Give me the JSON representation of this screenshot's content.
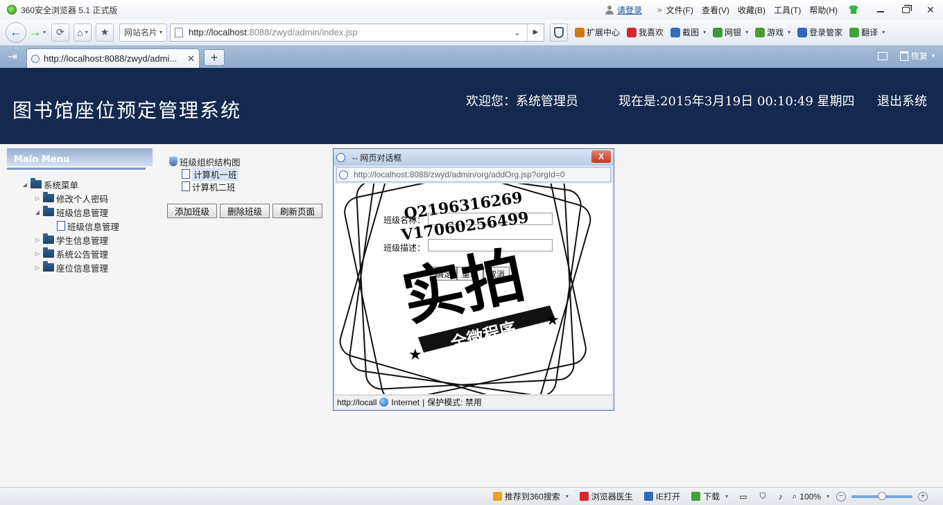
{
  "browser": {
    "app_title": "360安全浏览器 5.1 正式版",
    "login_link": "请登录",
    "menu": [
      "文件(F)",
      "查看(V)",
      "收藏(B)",
      "工具(T)",
      "帮助(H)"
    ],
    "site_card": "网站名片",
    "url_host": "http://localhost",
    "url_rest": ":8088/zwyd/admin/index.jsp",
    "toolbar_items": [
      {
        "icon": "extension-icon",
        "label": "扩展中心",
        "color": "#d27a16"
      },
      {
        "icon": "heart-icon",
        "label": "我喜欢",
        "color": "#d9262e"
      },
      {
        "icon": "screenshot-icon",
        "label": "截图",
        "color": "#2f6fb7"
      },
      {
        "icon": "bank-icon",
        "label": "网银",
        "color": "#3b9a33"
      },
      {
        "icon": "game-icon",
        "label": "游戏",
        "color": "#4d9b2f"
      },
      {
        "icon": "key-icon",
        "label": "登录管家",
        "color": "#2d68b5"
      },
      {
        "icon": "translate-icon",
        "label": "翻译",
        "color": "#3fa23a"
      }
    ],
    "tab_label": "http://localhost:8088/zwyd/admi...",
    "restore_label": "恢复"
  },
  "header": {
    "system_title": "图书馆座位预定管理系统",
    "welcome": "欢迎您：系统管理员",
    "now": "现在是:2015年3月19日  00:10:49 星期四",
    "logout": "退出系统"
  },
  "menu_panel": {
    "heading": "Main Menu",
    "items": [
      {
        "label": "系统菜单",
        "level": 0,
        "expanded": true,
        "type": "folder"
      },
      {
        "label": "修改个人密码",
        "level": 1,
        "expanded": false,
        "type": "folder"
      },
      {
        "label": "班级信息管理",
        "level": 1,
        "expanded": true,
        "type": "folder"
      },
      {
        "label": "班级信息管理",
        "level": 2,
        "expanded": false,
        "type": "doc"
      },
      {
        "label": "学生信息管理",
        "level": 1,
        "expanded": false,
        "type": "folder"
      },
      {
        "label": "系统公告管理",
        "level": 1,
        "expanded": false,
        "type": "folder"
      },
      {
        "label": "座位信息管理",
        "level": 1,
        "expanded": false,
        "type": "folder"
      }
    ]
  },
  "org_tree": {
    "root": "班级组织结构图",
    "children": [
      "计算机一班",
      "计算机二班"
    ],
    "selected": "计算机一班"
  },
  "org_buttons": {
    "add": "添加班级",
    "delete": "删除班级",
    "refresh": "刷新页面"
  },
  "dialog": {
    "title": "-- 网页对话框",
    "url": "http://localhost:8088/zwyd/admin/org/addOrg.jsp?orgId=0",
    "close_label": "X",
    "fields": [
      {
        "label": "班级名称：",
        "value": ""
      },
      {
        "label": "班级描述：",
        "value": ""
      }
    ],
    "buttons": [
      "确定",
      "重填",
      "取消"
    ],
    "status_url": "http://locall",
    "status_zone": "Internet",
    "status_mode": "保护模式: 禁用"
  },
  "watermark": {
    "line1": "Q2196316269",
    "line2": "V17060256499",
    "main": "实拍",
    "ribbon": "全微程序"
  },
  "statusbar": {
    "items": [
      {
        "icon": "search-recommend-icon",
        "label": "推荐到360搜索",
        "caret": true
      },
      {
        "icon": "doctor-icon",
        "label": "浏览器医生",
        "caret": false
      },
      {
        "icon": "ie-open-icon",
        "label": "IE打开",
        "caret": false
      },
      {
        "icon": "download-icon",
        "label": "下载",
        "caret": true
      }
    ],
    "zoom": "100%"
  }
}
